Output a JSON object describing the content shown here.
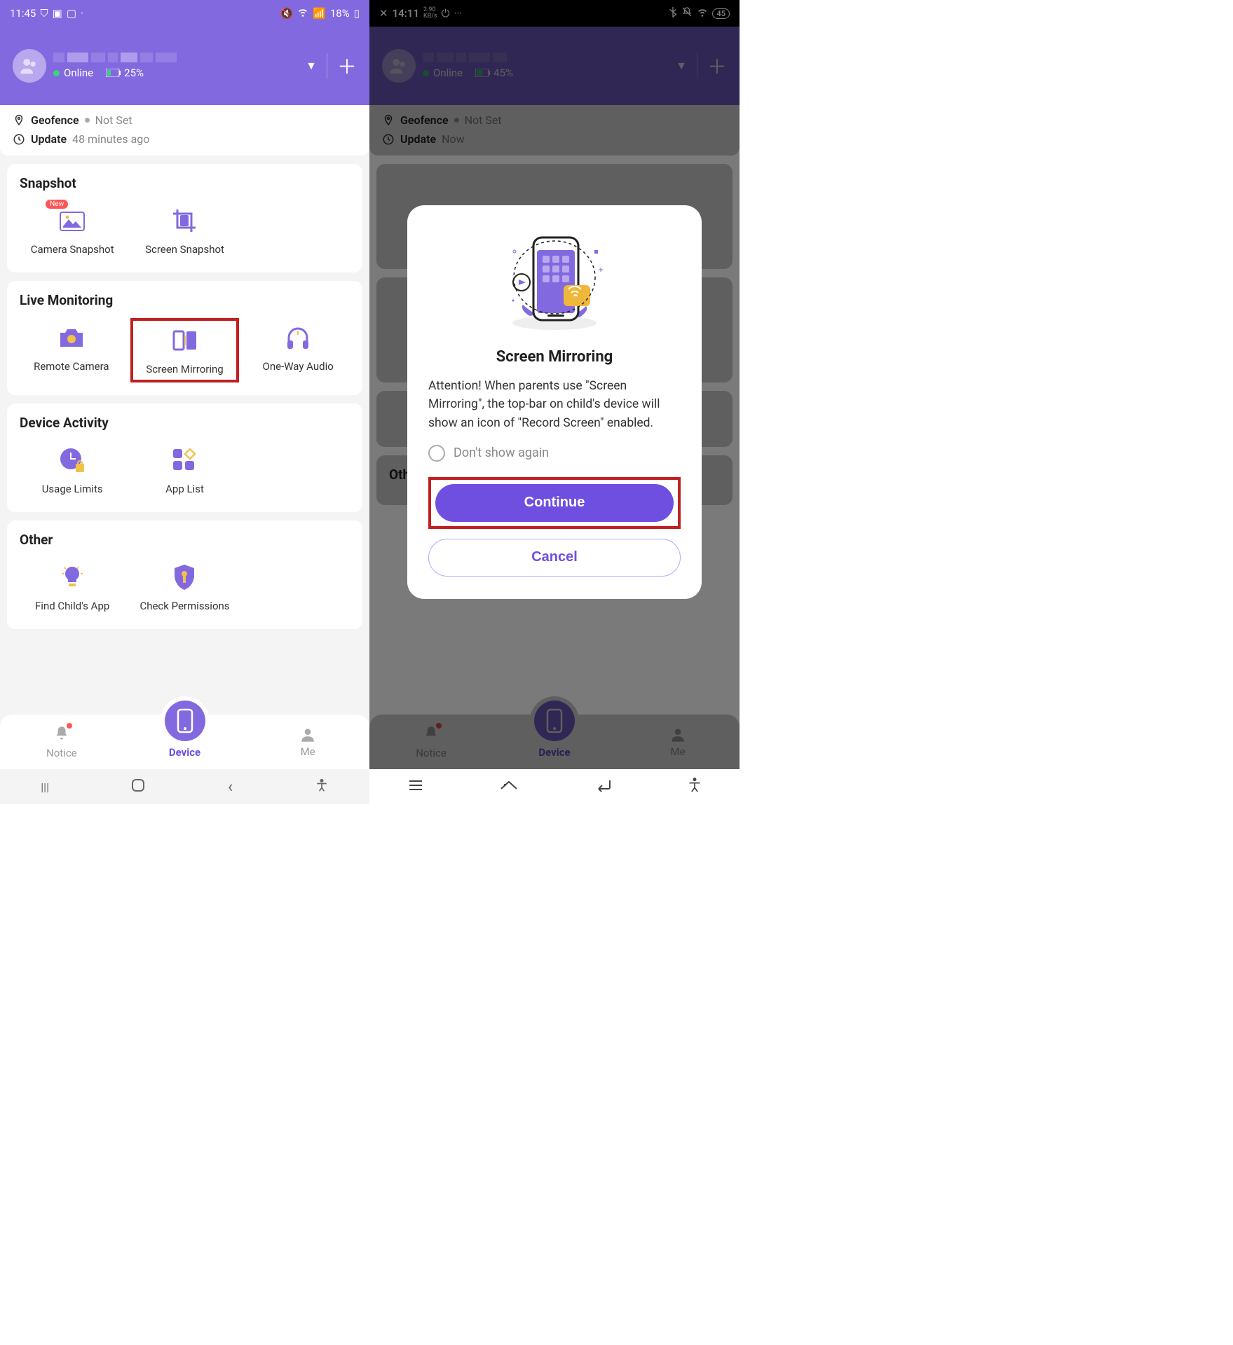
{
  "left": {
    "status": {
      "time": "11:45",
      "batt": "18%"
    },
    "header": {
      "status": "Online",
      "batt": "25%"
    },
    "geo": {
      "label": "Geofence",
      "value": "Not Set"
    },
    "upd": {
      "label": "Update",
      "value": "48 minutes ago"
    },
    "sections": {
      "snapshot": {
        "title": "Snapshot",
        "cam": "Camera Snapshot",
        "scr": "Screen Snapshot",
        "new": "New"
      },
      "live": {
        "title": "Live Monitoring",
        "remote": "Remote Camera",
        "mirror": "Screen Mirroring",
        "audio": "One-Way Audio"
      },
      "activity": {
        "title": "Device Activity",
        "usage": "Usage Limits",
        "apps": "App List"
      },
      "other": {
        "title": "Other",
        "find": "Find Child's App",
        "check": "Check Permissions"
      }
    },
    "nav": {
      "notice": "Notice",
      "device": "Device",
      "me": "Me"
    }
  },
  "right": {
    "status": {
      "time": "14:11",
      "rate": "2.90",
      "unit": "KB/s",
      "batt": "45"
    },
    "header": {
      "status": "Online",
      "batt": "45%"
    },
    "geo": {
      "label": "Geofence",
      "value": "Not Set"
    },
    "upd": {
      "label": "Update",
      "value": "Now"
    },
    "other": "Other",
    "modal": {
      "title": "Screen Mirroring",
      "body": "Attention! When parents use \"Screen Mirroring\", the top-bar on child's device will show an icon of \"Record Screen\" enabled.",
      "dontshow": "Don't show again",
      "continue": "Continue",
      "cancel": "Cancel"
    },
    "nav": {
      "notice": "Notice",
      "device": "Device",
      "me": "Me"
    }
  }
}
